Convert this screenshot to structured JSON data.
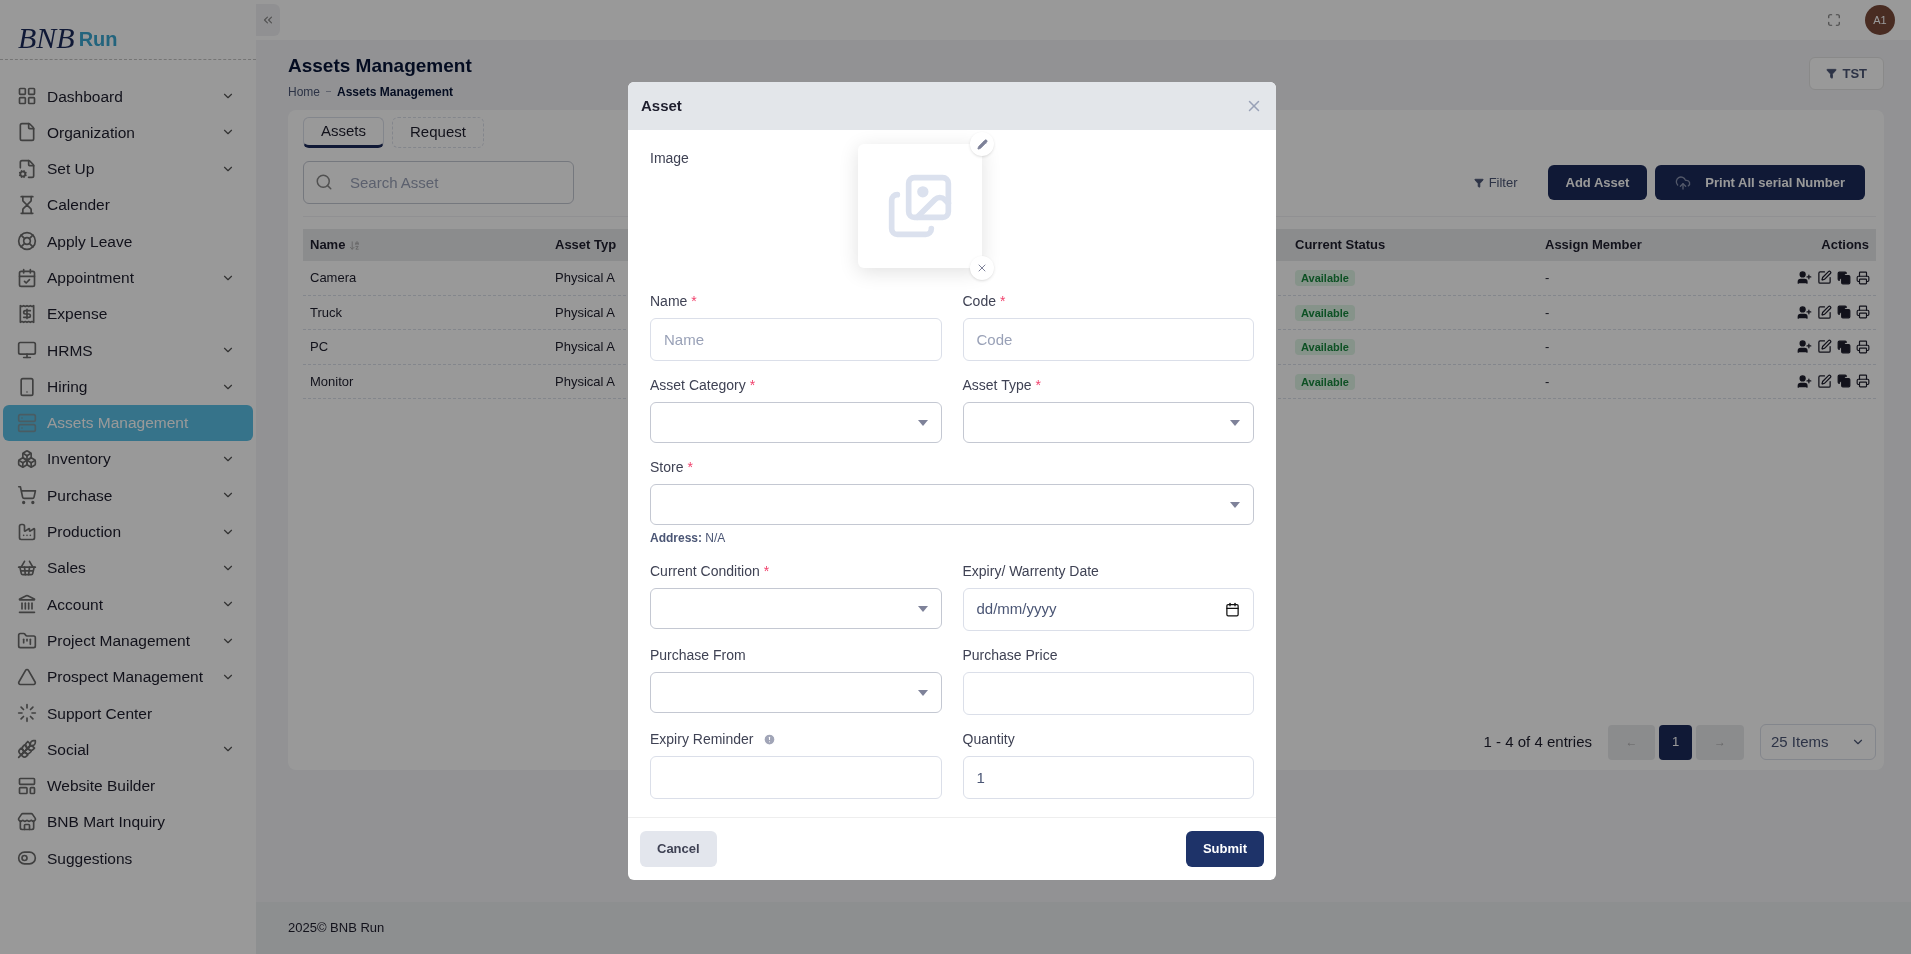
{
  "sidebar": {
    "logo": {
      "mark": "BNB",
      "name": "Run"
    },
    "items": [
      {
        "label": "Dashboard",
        "expandable": true,
        "selected": false
      },
      {
        "label": "Organization",
        "expandable": true,
        "selected": false
      },
      {
        "label": "Set Up",
        "expandable": true,
        "selected": false
      },
      {
        "label": "Calender",
        "expandable": false,
        "selected": false
      },
      {
        "label": "Apply Leave",
        "expandable": false,
        "selected": false
      },
      {
        "label": "Appointment",
        "expandable": true,
        "selected": false
      },
      {
        "label": "Expense",
        "expandable": false,
        "selected": false
      },
      {
        "label": "HRMS",
        "expandable": true,
        "selected": false
      },
      {
        "label": "Hiring",
        "expandable": true,
        "selected": false
      },
      {
        "label": "Assets Management",
        "expandable": false,
        "selected": true
      },
      {
        "label": "Inventory",
        "expandable": true,
        "selected": false
      },
      {
        "label": "Purchase",
        "expandable": true,
        "selected": false
      },
      {
        "label": "Production",
        "expandable": true,
        "selected": false
      },
      {
        "label": "Sales",
        "expandable": true,
        "selected": false
      },
      {
        "label": "Account",
        "expandable": true,
        "selected": false
      },
      {
        "label": "Project Management",
        "expandable": true,
        "selected": false
      },
      {
        "label": "Prospect Management",
        "expandable": true,
        "selected": false
      },
      {
        "label": "Support Center",
        "expandable": false,
        "selected": false
      },
      {
        "label": "Social",
        "expandable": true,
        "selected": false
      },
      {
        "label": "Website Builder",
        "expandable": false,
        "selected": false
      },
      {
        "label": "BNB Mart Inquiry",
        "expandable": false,
        "selected": false
      },
      {
        "label": "Suggestions",
        "expandable": false,
        "selected": false
      }
    ]
  },
  "topbar": {
    "avatar": "A1"
  },
  "page": {
    "title": "Assets Management",
    "breadcrumb": [
      "Home",
      "Assets Management"
    ],
    "filter_button": "TST"
  },
  "tabs": [
    {
      "label": "Assets",
      "selected": true
    },
    {
      "label": "Request",
      "selected": false
    }
  ],
  "search": {
    "placeholder": "Search Asset"
  },
  "toolbar": {
    "filter": "Filter",
    "add_button": "Add Asset",
    "print_button": "Print All serial Number"
  },
  "table": {
    "columns": [
      "Name",
      "Asset Typ",
      "Current Status",
      "Assign Member",
      "Actions"
    ],
    "rows": [
      {
        "name": "Camera",
        "asset_type": "Physical A",
        "status": "Available",
        "assign_member": "-"
      },
      {
        "name": "Truck",
        "asset_type": "Physical A",
        "status": "Available",
        "assign_member": "-"
      },
      {
        "name": "PC",
        "asset_type": "Physical A",
        "status": "Available",
        "assign_member": "-"
      },
      {
        "name": "Monitor",
        "asset_type": "Physical A",
        "status": "Available",
        "assign_member": "-"
      }
    ]
  },
  "pagination": {
    "summary": "1 - 4 of 4 entries",
    "prev": "←",
    "pages": [
      {
        "label": "1",
        "selected": true
      }
    ],
    "next": "→",
    "page_size": "25 Items"
  },
  "footer": "2025© BNB Run",
  "modal": {
    "title": "Asset",
    "image_label": "Image",
    "fields": [
      {
        "kind": "text",
        "label": "Name",
        "required_mark": "*",
        "placeholder": "Name"
      },
      {
        "kind": "text",
        "label": "Code",
        "required_mark": "*",
        "placeholder": "Code"
      },
      {
        "kind": "select",
        "label": "Asset Category",
        "required_mark": "*"
      },
      {
        "kind": "select",
        "label": "Asset Type",
        "required_mark": "*"
      },
      {
        "kind": "select",
        "label": "Store",
        "required_mark": "*",
        "wide": true,
        "helper": "**Address:** N/A"
      },
      {
        "kind": "select",
        "label": "Current Condition",
        "required_mark": "*"
      },
      {
        "kind": "date",
        "label": "Expiry/ Warrenty Date",
        "placeholder": "dd/mm/yyyy"
      },
      {
        "kind": "select",
        "label": "Purchase From"
      },
      {
        "kind": "text",
        "label": "Purchase Price"
      },
      {
        "kind": "text",
        "label": "Expiry Reminder",
        "info": true
      },
      {
        "kind": "text",
        "label": "Quantity",
        "value": "1"
      }
    ],
    "cancel": "Cancel",
    "submit": "Submit"
  }
}
